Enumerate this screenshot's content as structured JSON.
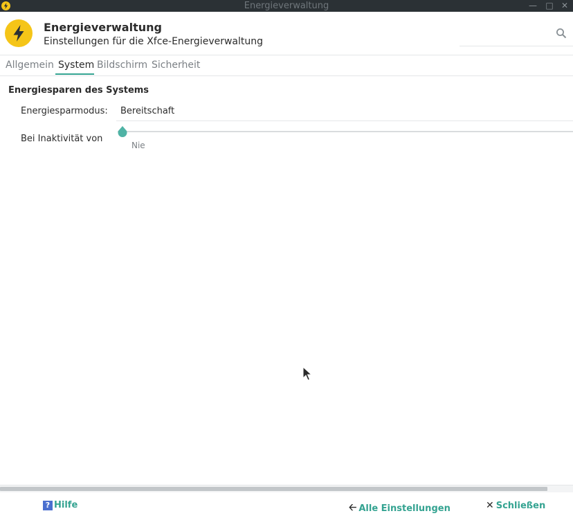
{
  "window": {
    "title": "Energieverwaltung"
  },
  "header": {
    "title": "Energieverwaltung",
    "subtitle": "Einstellungen für die Xfce-Energieverwaltung",
    "search_placeholder": ""
  },
  "tabs": [
    {
      "label": "Allgemein",
      "active": false
    },
    {
      "label": "System",
      "active": true
    },
    {
      "label": "Bildschirm",
      "active": false
    },
    {
      "label": "Sicherheit",
      "active": false
    }
  ],
  "system": {
    "section_title": "Energiesparen des Systems",
    "mode_label": "Energiesparmodus:",
    "mode_value": "Bereitschaft",
    "inactivity_label": "Bei Inaktivität von",
    "inactivity_value": "Nie",
    "inactivity_slider_fraction": 0.0
  },
  "footer": {
    "help_label": "Hilfe",
    "all_settings_label": "Alle Einstellungen",
    "close_label": "Schließen"
  },
  "colors": {
    "accent": "#34a391",
    "titlebar": "#2b3135",
    "icon_yellow": "#f5c518",
    "help_blue": "#4a6fcf"
  },
  "icons": {
    "app": "lightning-icon",
    "search": "search-icon",
    "help": "help-icon",
    "back": "arrow-left-icon",
    "close": "close-icon"
  }
}
